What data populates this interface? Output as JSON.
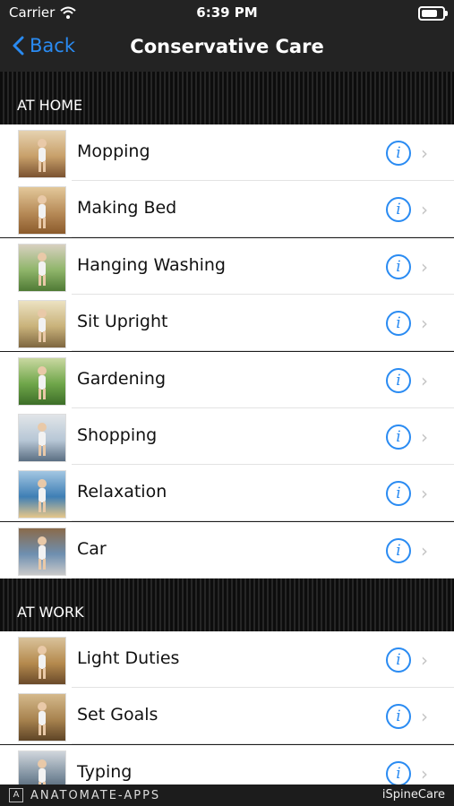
{
  "status_bar": {
    "carrier": "Carrier",
    "time": "6:39 PM",
    "battery_level": 0.95
  },
  "nav": {
    "back_label": "Back",
    "title": "Conservative Care"
  },
  "sections": [
    {
      "header": "AT HOME",
      "items": [
        {
          "label": "Mopping",
          "icon": "mopping-thumbnail"
        },
        {
          "label": "Making Bed",
          "icon": "making-bed-thumbnail"
        },
        {
          "label": "Hanging Washing",
          "icon": "hanging-washing-thumbnail"
        },
        {
          "label": "Sit Upright",
          "icon": "sit-upright-thumbnail"
        },
        {
          "label": "Gardening",
          "icon": "gardening-thumbnail"
        },
        {
          "label": "Shopping",
          "icon": "shopping-thumbnail"
        },
        {
          "label": "Relaxation",
          "icon": "relaxation-thumbnail"
        },
        {
          "label": "Car",
          "icon": "car-thumbnail"
        }
      ]
    },
    {
      "header": "AT WORK",
      "items": [
        {
          "label": "Light Duties",
          "icon": "light-duties-thumbnail"
        },
        {
          "label": "Set Goals",
          "icon": "set-goals-thumbnail"
        },
        {
          "label": "Typing",
          "icon": "typing-thumbnail"
        }
      ]
    }
  ],
  "info_icon_glyph": "i",
  "chevron_glyph": "›",
  "footer": {
    "brand": "ANATOMATE-APPS",
    "logo_glyph": "A",
    "app_name": "iSpineCare"
  },
  "colors": {
    "accent": "#2a8bf2",
    "bar": "#232323",
    "row_bg": "#ffffff"
  }
}
